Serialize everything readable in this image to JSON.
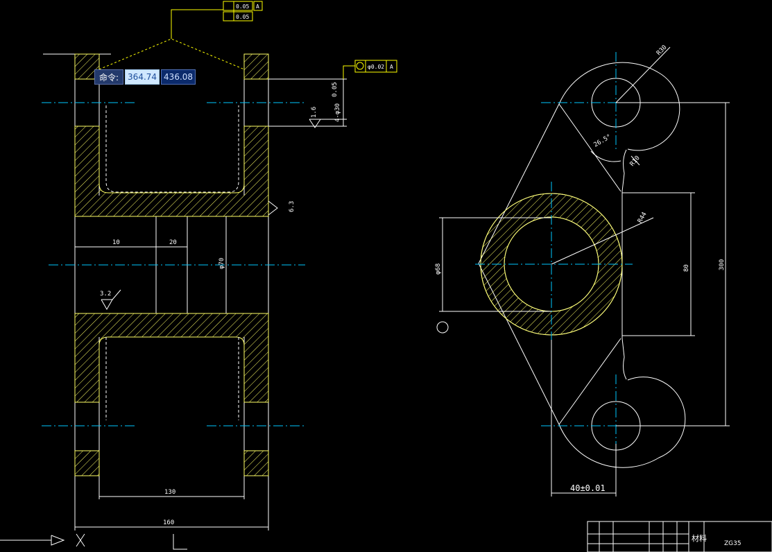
{
  "command": {
    "label": "命令:",
    "x_value": "364.74",
    "y_value": "436.08"
  },
  "dimensions": {
    "left_width_10": "10",
    "left_width_20": "20",
    "left_bore_dia": "φ70",
    "left_inner_width": "130",
    "left_total_width": "160",
    "left_depth_label": "4-φ30",
    "left_depth_value": "0.05",
    "roughness_top": "1.6",
    "roughness_right": "6.3",
    "roughness_mid": "3.2",
    "right_radius_top": "R30",
    "right_angle": "26.5°",
    "right_fillet": "R10",
    "right_main_radius": "R44",
    "right_center_span": "80",
    "right_total_span": "300",
    "right_bore": "φ68",
    "right_offset": "40±0.01"
  },
  "frames": {
    "top_1": "0.05",
    "top_2": "0.05",
    "top_ref": "A",
    "pos_sym": "φ0.02",
    "pos_ref": "A"
  },
  "title_block": {
    "material_label": "材料",
    "drawing_no": "ZG35"
  },
  "colors": {
    "line": "#ffffff",
    "hatch": "#ffff66",
    "center": "#00c8ff",
    "annot": "#ffff00",
    "background": "#000000"
  }
}
